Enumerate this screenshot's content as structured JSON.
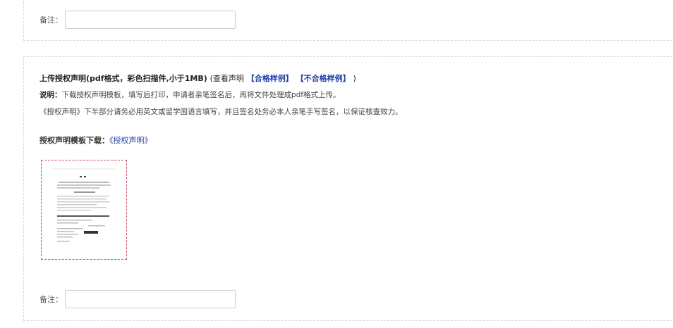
{
  "top_section": {
    "remark_label": "备注："
  },
  "upload_section": {
    "title": "上传授权声明(pdf格式，彩色扫描件,小于1MB)",
    "view_prefix": "(查看声明",
    "link_qualified": "【合格样例】",
    "link_unqualified": "【不合格样例】",
    "view_suffix": ")",
    "note_label": "说明：",
    "note_text": "下载授权声明模板，填写后打印，申请者亲笔签名后，再将文件处理成pdf格式上传。",
    "note_text2": "《授权声明》下半部分请务必用英文或留学国语言填写，并且签名处务必本人亲笔手写签名，以保证核查效力。",
    "download_label": "授权声明模板下载：",
    "download_link": "《授权声明》",
    "remark_label": "备注："
  },
  "colors": {
    "link": "#1f3fa8",
    "dashed_border": "#d8d8d8",
    "thumb_border": "#c94a5a"
  }
}
